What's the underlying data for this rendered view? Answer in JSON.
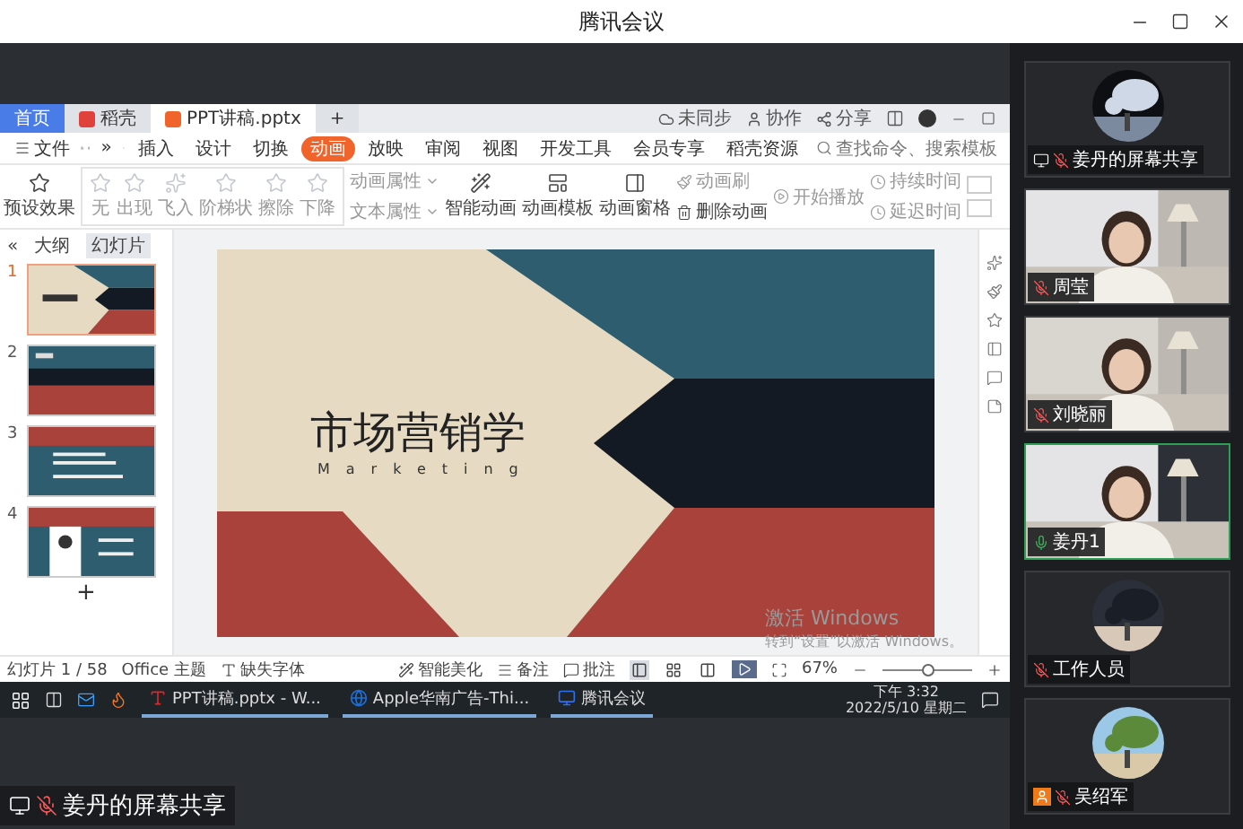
{
  "window": {
    "title": "腾讯会议"
  },
  "shared_screen": {
    "wps_tabs": [
      {
        "label": "首页",
        "selected": false,
        "kind": "home"
      },
      {
        "label": "稻壳",
        "selected": false,
        "kind": "docer"
      },
      {
        "label": "PPT讲稿.pptx",
        "selected": true,
        "kind": "doc"
      },
      {
        "label": "+",
        "selected": false,
        "kind": "add"
      }
    ],
    "file_menu": "文件",
    "more": "»",
    "ribbon_tabs": [
      {
        "label": "插入",
        "selected": false
      },
      {
        "label": "设计",
        "selected": false
      },
      {
        "label": "切换",
        "selected": false
      },
      {
        "label": "动画",
        "selected": true
      },
      {
        "label": "放映",
        "selected": false
      },
      {
        "label": "审阅",
        "selected": false
      },
      {
        "label": "视图",
        "selected": false
      },
      {
        "label": "开发工具",
        "selected": false
      },
      {
        "label": "会员专享",
        "selected": false
      },
      {
        "label": "稻壳资源",
        "selected": false
      }
    ],
    "search": {
      "placeholder": "查找命令、搜索模板"
    },
    "actions": [
      "未同步",
      "协作",
      "分享"
    ],
    "ribbon": {
      "preset": "预设效果",
      "effects": [
        "无",
        "出现",
        "飞入",
        "阶梯状",
        "擦除",
        "下降"
      ],
      "props": [
        "动画属性",
        "文本属性"
      ],
      "tools": [
        "智能动画",
        "动画模板",
        "动画窗格"
      ],
      "brush": [
        "动画刷",
        "删除动画"
      ],
      "play": "开始播放",
      "timing": [
        "持续时间",
        "延迟时间"
      ]
    },
    "panel": {
      "collapse": "«",
      "tabs": [
        {
          "label": "大纲",
          "selected": false
        },
        {
          "label": "幻灯片",
          "selected": true
        }
      ],
      "slides": [
        {
          "number": "1",
          "selected": true,
          "kind": "title"
        },
        {
          "number": "2",
          "selected": false,
          "kind": "toc"
        },
        {
          "number": "3",
          "selected": false,
          "kind": "text"
        },
        {
          "number": "4",
          "selected": false,
          "kind": "figure"
        }
      ],
      "add": "+"
    },
    "slide": {
      "title": "市场营销学",
      "subtitle": "Marketing"
    },
    "activation": {
      "title": "激活 Windows",
      "hint": "转到“设置”以激活 Windows。"
    },
    "status_bar": {
      "slide_count": "幻灯片 1 / 58",
      "theme": "Office 主题",
      "missing_font": "缺失字体",
      "beautify": "智能美化",
      "notes": "备注",
      "comments": "批注",
      "views": [
        {
          "selected": true
        },
        {
          "selected": false
        },
        {
          "selected": false
        }
      ],
      "zoom": "67%",
      "zoom_slider": {
        "level": 0.5
      }
    },
    "taskbar": {
      "apps": [
        {
          "label": "PPT讲稿.pptx - W...",
          "kind": "wps"
        },
        {
          "label": "Apple华南广告-Thi...",
          "kind": "browser"
        },
        {
          "label": "腾讯会议",
          "kind": "meeting"
        }
      ],
      "time": "下午 3:32",
      "date": "2022/5/10 星期二"
    }
  },
  "share_label": "姜丹的屏幕共享",
  "participants": [
    {
      "name": "姜丹的屏幕共享",
      "kind": "share",
      "muted": true,
      "speaking": false,
      "host": false
    },
    {
      "name": "周莹",
      "kind": "video",
      "muted": true,
      "speaking": false,
      "host": false
    },
    {
      "name": "刘晓丽",
      "kind": "video",
      "muted": true,
      "speaking": false,
      "host": false
    },
    {
      "name": "姜丹1",
      "kind": "video",
      "muted": false,
      "speaking": true,
      "host": false
    },
    {
      "name": "工作人员",
      "kind": "avatar",
      "muted": true,
      "speaking": false,
      "host": false
    },
    {
      "name": "吴绍军",
      "kind": "avatar",
      "muted": true,
      "speaking": false,
      "host": true
    }
  ]
}
